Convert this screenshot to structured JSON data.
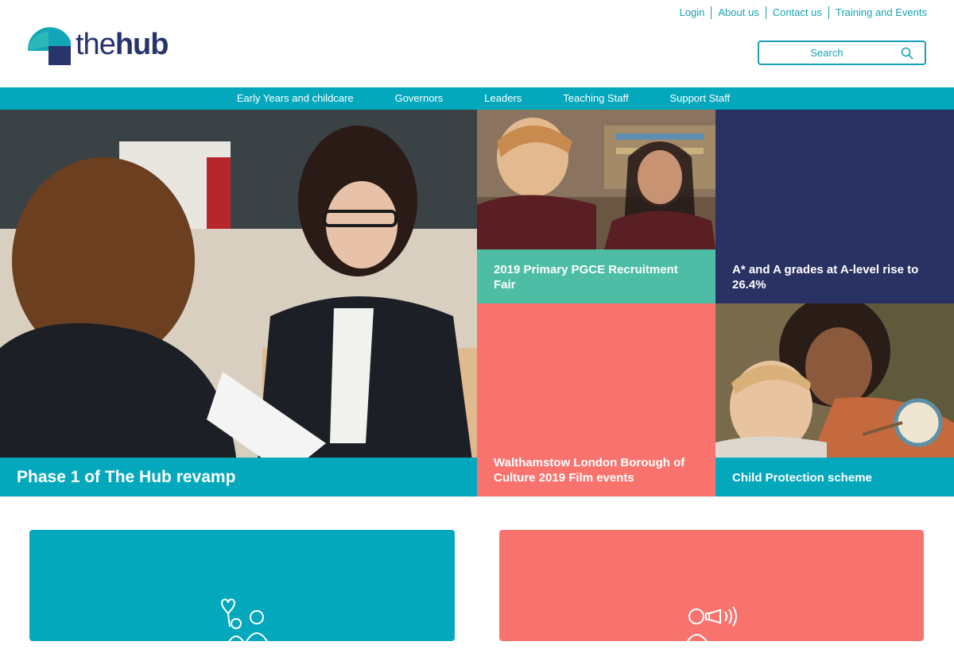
{
  "brand": {
    "name_the": "the",
    "name_hub": "hub",
    "colors": {
      "teal": "#04a8bd",
      "navy": "#27336b",
      "coral": "#f9736e",
      "green": "#4dbda6",
      "darkblue": "#2a3163"
    }
  },
  "toplinks": [
    "Login",
    "About us",
    "Contact us",
    "Training and Events"
  ],
  "search": {
    "placeholder": "Search",
    "icon": "search-icon"
  },
  "nav": [
    "Early Years and childcare",
    "Governors",
    "Leaders",
    "Teaching Staff",
    "Support Staff"
  ],
  "hero": {
    "caption": "Phase 1 of The Hub revamp"
  },
  "tiles": [
    {
      "caption": "2019 Primary PGCE Recruitment Fair"
    },
    {
      "caption": "A* and A grades at A-level rise to 26.4%"
    },
    {
      "caption": "Walthamstow London Borough of Culture 2019 Film events"
    },
    {
      "caption": "Child Protection scheme"
    }
  ],
  "cards": [
    {
      "icon": "family-heart-icon",
      "color": "#04a8bd"
    },
    {
      "icon": "person-megaphone-icon",
      "color": "#f9736e"
    }
  ]
}
